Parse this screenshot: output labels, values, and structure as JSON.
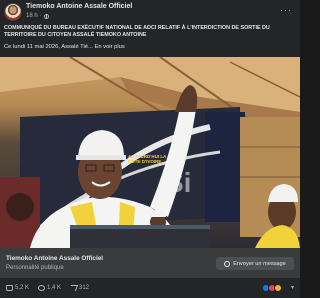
{
  "post": {
    "author": "Tiemoko Antoine Assale Officiel",
    "time": "18 h",
    "more": "···",
    "title": "COMMUNIQUÉ DU BUREAU EXÉCUTIF NATIONAL DE ADCI RELATIF À L'INTERDICTION DE SORTIE DU TERRITOIRE DU CITOYEN ASSALÉ TIEMOKO ANTOINE",
    "excerpt": "Ce lundi 11 mai 2026, Assalé Tié...",
    "see_more": "En voir plus"
  },
  "photo": {
    "banner_text": "AUJOURD'HUI LA CÔTE D'IVOIRE",
    "banner_large": "Si"
  },
  "page": {
    "name": "Tiemoko Antoine Assale Officiel",
    "category": "Personnalité publique",
    "message_button": "Envoyer un message"
  },
  "stats": {
    "likes": "5,2 K",
    "comments": "1,4 K",
    "shares": "312"
  },
  "icons": {
    "globe": "globe-icon",
    "like": "like-icon",
    "comment": "comment-icon",
    "share": "share-icon",
    "messenger": "messenger-icon"
  },
  "colors": {
    "background": "#242526",
    "text": "#e4e6eb",
    "secondary_text": "#b0b3b8",
    "page_bar": "#3a3b3c",
    "accent_yellow": "#f2d23a"
  }
}
